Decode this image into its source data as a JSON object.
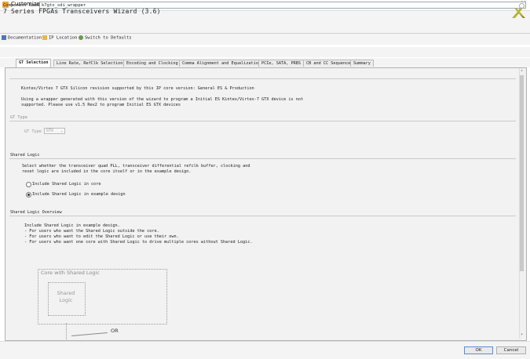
{
  "window": {
    "title": "Customize IP",
    "close_glyph": "✕"
  },
  "header": {
    "wizard_title": "7 Series FPGAs Transceivers Wizard (3.6)",
    "logo_icon": "xilinx-logo-icon"
  },
  "toolbar": {
    "documentation": "Documentation",
    "ip_location": "IP Location",
    "switch_defaults": "Switch to Defaults"
  },
  "component": {
    "label": "Component Name",
    "value": "k7gtx_sdi_wrapper"
  },
  "tabs": [
    {
      "label": "GT Selection",
      "active": true
    },
    {
      "label": "Line Rate, RefClk Selection",
      "active": false
    },
    {
      "label": "Encoding and Clocking",
      "active": false
    },
    {
      "label": "Comma Alignment and Equalization",
      "active": false
    },
    {
      "label": "PCIe, SATA, PRBS",
      "active": false
    },
    {
      "label": "CB and CC Sequence",
      "active": false
    },
    {
      "label": "Summary",
      "active": false
    }
  ],
  "content": {
    "silicon_note": "Kintex/Virtex 7 GTX Silicon revision supported by this IP core version: General ES & Production",
    "wrapper_note_1": "Using a wrapper generated with this version of the wizard to program a Initial ES Kintex/Virtex-7 GTX device is not",
    "wrapper_note_2": "supported. Please use v1.5 Rev2 to program Initial ES GTX devices",
    "gt_type_section": "GT Type",
    "gt_type_label": "GT Type",
    "gt_type_value": "GTX",
    "shared_logic_section": "Shared Logic",
    "shared_logic_desc_1": "Select whether the transceiver quad PLL, transceiver differential refclk buffer, clocking and",
    "shared_logic_desc_2": "reset logic are included in the core itself or in the example design.",
    "radio_core": "Include Shared Logic in core",
    "radio_example": "Include Shared Logic in example design",
    "overview_section": "Shared Logic Overview",
    "overview_1": "Include Shared Logic in example design.",
    "overview_2": "- For users who want the Shared Logic outside the core.",
    "overview_3": "- For users who want to edit the Shared Logic or use their own.",
    "overview_4": "- For users who want one core with Shared Logic to drive multiple cores without Shared Logic.",
    "diagram_outer": "Core with Shared Logic",
    "diagram_inner_1": "Shared",
    "diagram_inner_2": "Logic",
    "diagram_or": "OR"
  },
  "buttons": {
    "ok": "OK",
    "cancel": "Cancel"
  },
  "colors": {
    "accent": "#5a8bd6",
    "logo": "#b6b62a"
  }
}
